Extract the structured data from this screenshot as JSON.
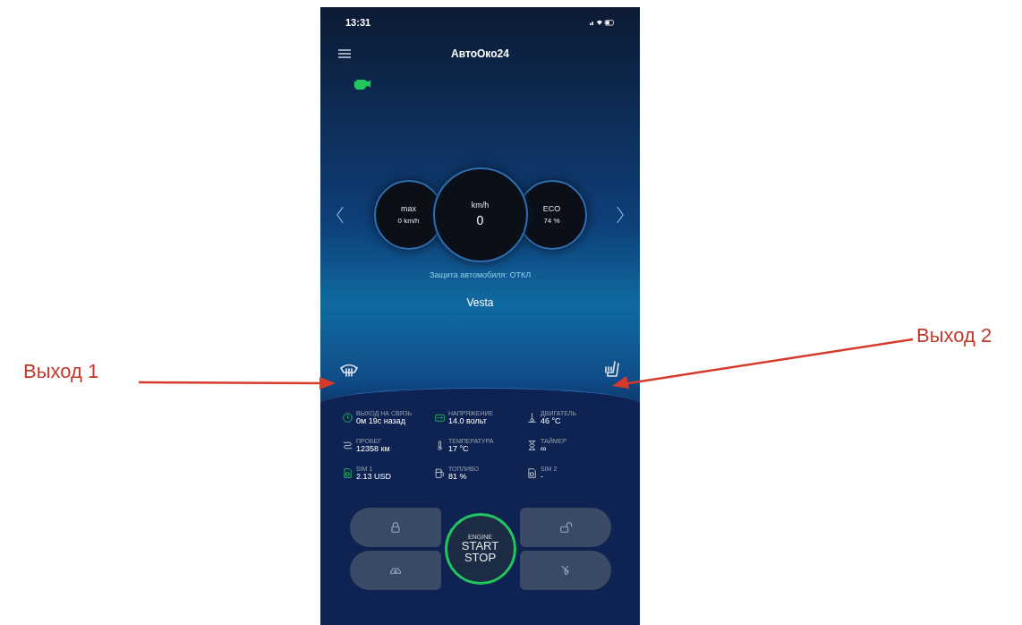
{
  "phone": {
    "status_bar": {
      "time": "13:31"
    },
    "header": {
      "title": "АвтоОко24"
    },
    "gauges": [
      {
        "kind": "side",
        "label": "max",
        "value": "0 km/h"
      },
      {
        "kind": "main",
        "label": "km/h",
        "value": "0"
      },
      {
        "kind": "side",
        "label": "ECO",
        "value": "74 %"
      }
    ],
    "protection_status": "Защита автомобиля: ОТКЛ",
    "car_name": "Vesta",
    "outputs": [
      {
        "kind": "defrost"
      },
      {
        "kind": "seat-heat"
      }
    ],
    "info": [
      {
        "label": "ВЫХОД НА СВЯЗЬ",
        "value": "0м 19с назад",
        "accent": true
      },
      {
        "label": "НАПРЯЖЕНИЕ",
        "value": "14.0 вольт",
        "accent": true
      },
      {
        "label": "ДВИГАТЕЛЬ",
        "value": "46 °C",
        "accent": false
      },
      {
        "label": "ПРОБЕГ",
        "value": "12358 км",
        "accent": false
      },
      {
        "label": "ТЕМПЕРАТУРА",
        "value": "17 °C",
        "accent": false
      },
      {
        "label": "ТАЙМЕР",
        "value": "∞",
        "accent": false
      },
      {
        "label": "SIM 1",
        "value": "2.13 USD",
        "accent": true
      },
      {
        "label": "ТОПЛИВО",
        "value": "81 %",
        "accent": false
      },
      {
        "label": "SIM 2",
        "value": "-",
        "accent": false
      }
    ],
    "controls": {
      "engine_button": {
        "small": "ENGINE",
        "line1": "START",
        "line2": "STOP"
      },
      "buttons": [
        {
          "kind": "lock"
        },
        {
          "kind": "unlock"
        },
        {
          "kind": "horn"
        },
        {
          "kind": "trunk"
        }
      ]
    }
  },
  "annotations": [
    {
      "text": "Выход 1"
    },
    {
      "text": "Выход 2"
    }
  ]
}
